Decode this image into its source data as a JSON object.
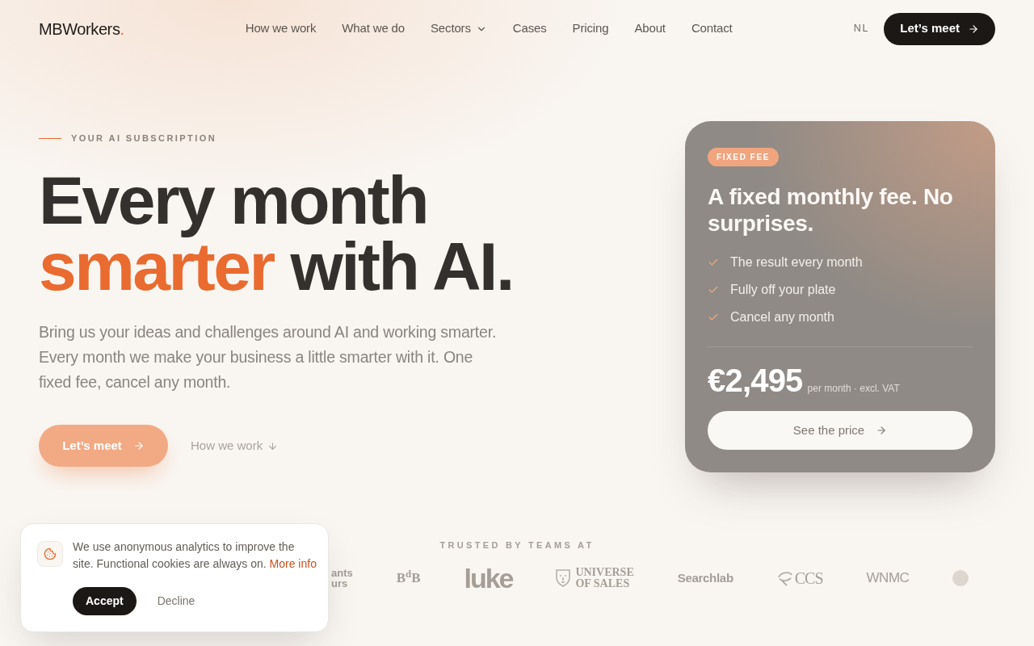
{
  "header": {
    "logo": {
      "text": "MBWorkers",
      "dot": "."
    },
    "nav": [
      {
        "label": "How we work",
        "dropdown": false
      },
      {
        "label": "What we do",
        "dropdown": false
      },
      {
        "label": "Sectors",
        "dropdown": true
      },
      {
        "label": "Cases",
        "dropdown": false
      },
      {
        "label": "Pricing",
        "dropdown": false
      },
      {
        "label": "About",
        "dropdown": false
      },
      {
        "label": "Contact",
        "dropdown": false
      }
    ],
    "language": "NL",
    "cta": "Let’s meet"
  },
  "hero": {
    "eyebrow": "YOUR AI SUBSCRIPTION",
    "heading": {
      "line_1": "Every month",
      "highlight": "smarter",
      "rest": "with AI."
    },
    "intro": "Bring us your ideas and challenges around AI and working smarter. Every month we make your business a little smarter with it. One fixed fee, cancel any month.",
    "primary_button": "Let’s meet",
    "secondary_link": "How we work"
  },
  "pricing_card": {
    "badge": "FIXED FEE",
    "title": "A fixed monthly fee. No surprises.",
    "features": [
      "The result every month",
      "Fully off your plate",
      "Cancel any month"
    ],
    "price": "€2,495",
    "price_note": "per month · excl. VAT",
    "button": "See the price"
  },
  "trusted": {
    "label": "TRUSTED BY TEAMS AT",
    "logos": [
      {
        "kind": "stacked",
        "lines": [
          "ants",
          "urs"
        ]
      },
      {
        "kind": "monogram",
        "text": "B$^{d}$B"
      },
      {
        "kind": "heavy",
        "text": "luke"
      },
      {
        "kind": "emblem",
        "lines": [
          "UNIVERSE",
          "OF SALES"
        ]
      },
      {
        "kind": "wordmark",
        "text": "Searchlab"
      },
      {
        "kind": "swoosh",
        "text": "CCS"
      },
      {
        "kind": "outline",
        "text": "WNMC"
      },
      {
        "kind": "seal"
      }
    ]
  },
  "cookie_banner": {
    "message": "We use anonymous analytics to improve the site. Functional cookies are always on.",
    "link": "More info",
    "accept": "Accept",
    "decline": "Decline"
  }
}
